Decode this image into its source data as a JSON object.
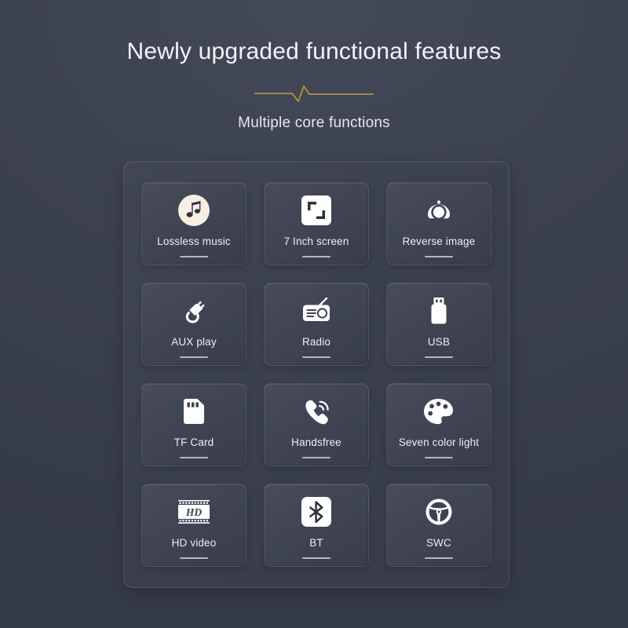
{
  "header": {
    "title": "Newly upgraded functional features",
    "subtitle": "Multiple core functions",
    "divider_icon": "heartbeat-divider",
    "divider_color": "#c59a3f"
  },
  "theme": {
    "background_top": "#434959",
    "background_bottom": "#353a4a",
    "card_background_light": "#474c5b",
    "card_background_dark": "#383d4c",
    "text_color": "#eceef2",
    "accent_color": "#c59a3f",
    "icon_color": "#ffffff",
    "underline_color": "#c9ccd4"
  },
  "features": [
    {
      "label": "Lossless music",
      "icon": "music-note-icon"
    },
    {
      "label": "7 Inch screen",
      "icon": "expand-screen-icon"
    },
    {
      "label": "Reverse image",
      "icon": "camera-icon"
    },
    {
      "label": "AUX play",
      "icon": "aux-plug-icon"
    },
    {
      "label": "Radio",
      "icon": "radio-icon"
    },
    {
      "label": "USB",
      "icon": "usb-drive-icon"
    },
    {
      "label": "TF Card",
      "icon": "memory-card-icon"
    },
    {
      "label": "Handsfree",
      "icon": "phone-handset-icon"
    },
    {
      "label": "Seven color light",
      "icon": "paint-palette-icon"
    },
    {
      "label": "HD video",
      "icon": "film-hd-icon"
    },
    {
      "label": "BT",
      "icon": "bluetooth-icon"
    },
    {
      "label": "SWC",
      "icon": "steering-wheel-icon"
    }
  ]
}
